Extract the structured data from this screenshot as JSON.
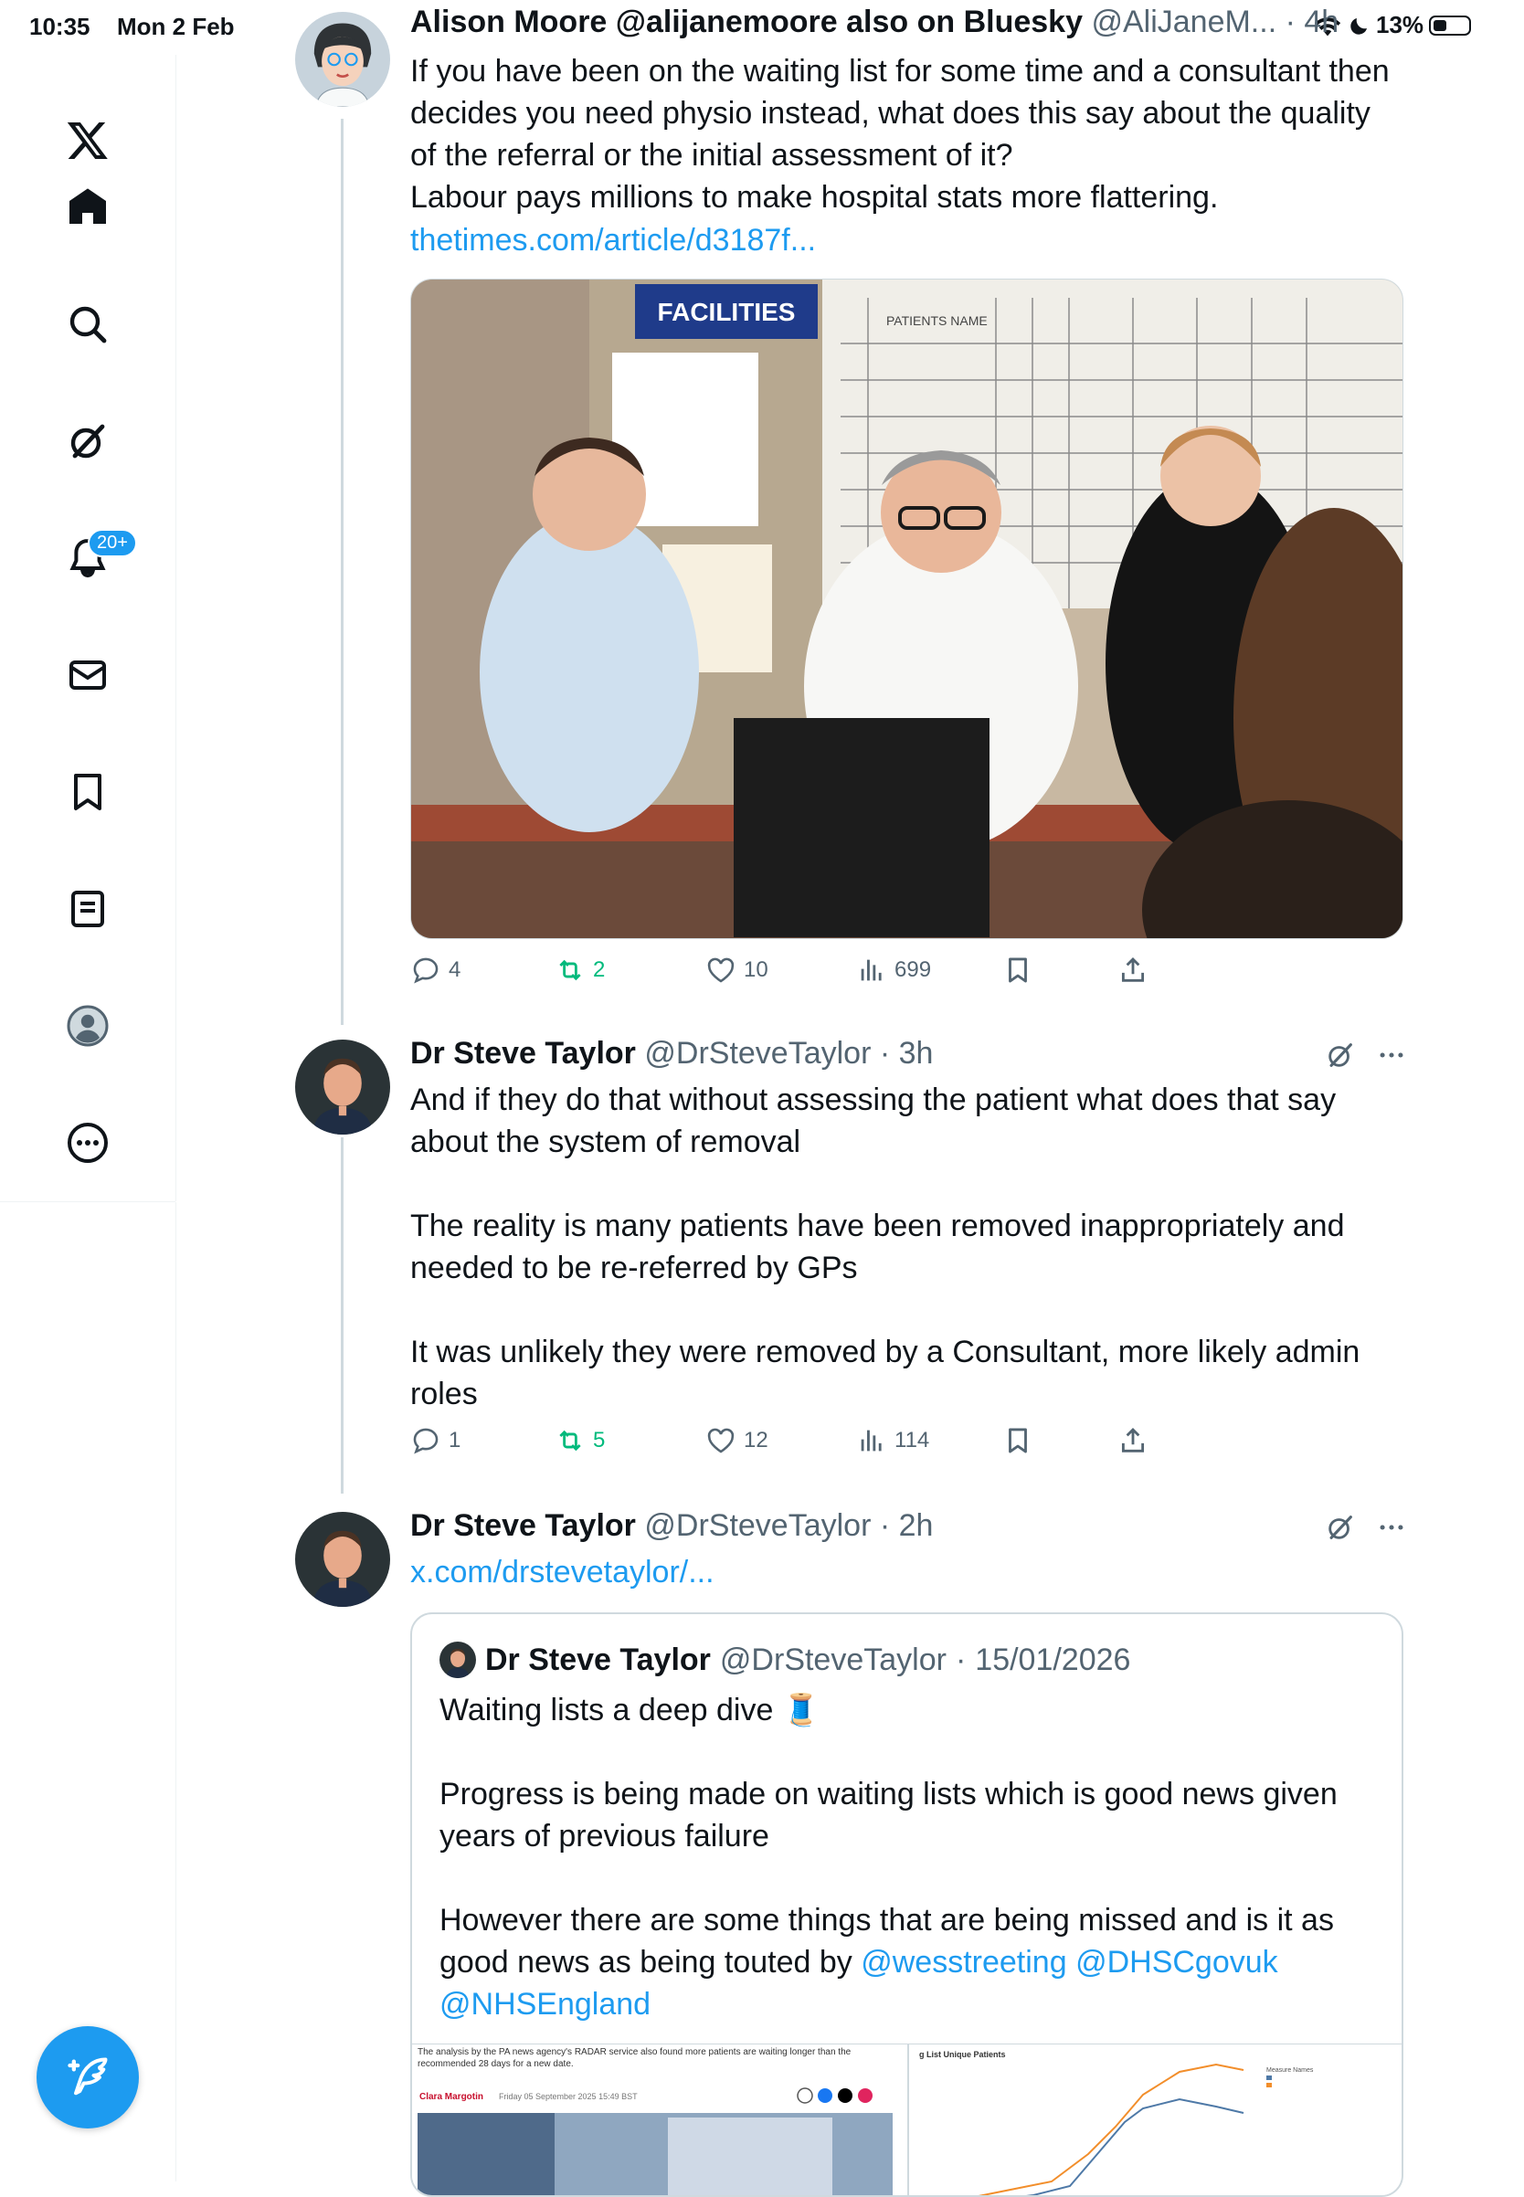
{
  "status_bar": {
    "time": "10:35",
    "date": "Mon 2 Feb",
    "battery": "13%"
  },
  "sidebar": {
    "notifications_badge": "20+"
  },
  "posts": [
    {
      "name": "Alison Moore @alijanemoore also on Bluesky",
      "handle": "@AliJaneM...",
      "time": "4h",
      "text": "If you have been on the waiting list for some time and a consultant then decides you need physio instead, what does this say about the quality of the referral or the initial assessment of it?\nLabour pays millions to make hospital stats more flattering.",
      "link": "thetimes.com/article/d3187f...",
      "media_texts": {
        "sign": "FACILITIES",
        "board_col_patient": "PATIENTS NAME"
      },
      "stats": {
        "replies": "4",
        "reposts": "2",
        "likes": "10",
        "views": "699"
      }
    },
    {
      "name": "Dr Steve Taylor",
      "handle": "@DrSteveTaylor",
      "time": "3h",
      "text": "And if they do that without assessing the patient what does that say about the system of removal\n\nThe reality is many patients have been removed inappropriately and needed to be re-referred by GPs\n\nIt was unlikely they were removed by a Consultant, more likely admin roles",
      "stats": {
        "replies": "1",
        "reposts": "5",
        "likes": "12",
        "views": "114"
      }
    },
    {
      "name": "Dr Steve Taylor",
      "handle": "@DrSteveTaylor",
      "time": "2h",
      "link": "x.com/drstevetaylor/...",
      "quote": {
        "name": "Dr Steve Taylor",
        "handle": "@DrSteveTaylor",
        "date": "15/01/2026",
        "text_lead": "Waiting lists a deep dive 🧵\n\nProgress is being made on waiting lists which is good news given years of previous failure\n\nHowever there are some things that are being missed and is it as good news as being touted by ",
        "mention_1": "@wesstreeting",
        "mention_2": "@DHSCgovuk",
        "mention_3": "@NHSEngland",
        "media_left_text": "The analysis by the PA news agency's RADAR service also found more patients are waiting longer than the recommended 28 days for a new date.",
        "media_left_author": "Clara Margotin",
        "media_left_date": "Friday 05 September 2025 15:49 BST",
        "media_right_title": "g List Unique Patients",
        "media_right_legend": "Measure Names"
      }
    }
  ],
  "colors": {
    "accent": "#1d9bf0",
    "repost": "#00ba7c",
    "muted": "#536471"
  }
}
